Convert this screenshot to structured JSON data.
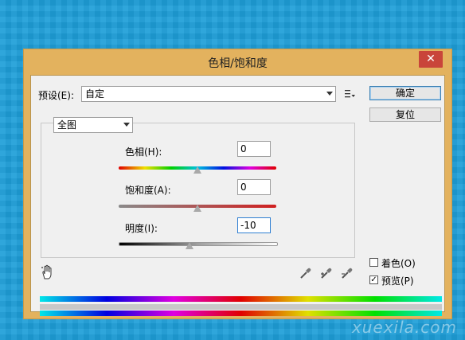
{
  "dialog": {
    "title": "色相/饱和度",
    "close_glyph": "✕"
  },
  "preset": {
    "label": "预设(E):",
    "value": "自定"
  },
  "buttons": {
    "ok": "确定",
    "reset": "复位"
  },
  "channel": {
    "value": "全图"
  },
  "hue": {
    "label": "色相(H):",
    "value": "0",
    "slider_fraction": 0.5
  },
  "saturation": {
    "label": "饱和度(A):",
    "value": "0",
    "slider_fraction": 0.5
  },
  "lightness": {
    "label": "明度(I):",
    "value": "-10",
    "slider_fraction": 0.45
  },
  "options": {
    "colorize_label": "着色(O)",
    "colorize_checked": false,
    "preview_label": "预览(P)",
    "preview_checked": true,
    "check_glyph": "✓"
  },
  "icons": {
    "menu": "options-menu-icon",
    "hand": "targeted-adjustment-hand-icon",
    "eyedropper": "eyedropper-icon",
    "eyedropper_plus": "eyedropper-plus-icon",
    "eyedropper_minus": "eyedropper-minus-icon"
  },
  "watermark": "xuexila.com",
  "colors": {
    "titlebar": "#e3b25e",
    "close_button": "#c9453a",
    "desktop": "#1e9ed8"
  }
}
